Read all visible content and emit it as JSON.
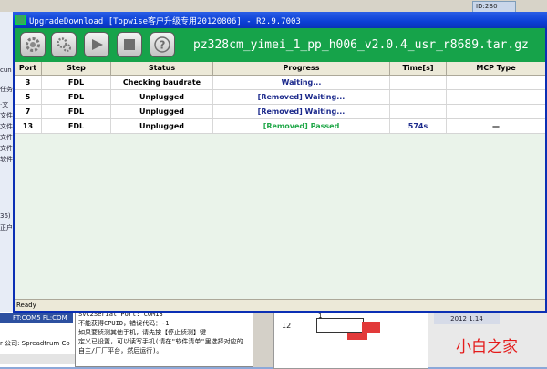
{
  "window": {
    "title": "UpgradeDownload [Topwise客户升级专用20120806] - R2.9.7003"
  },
  "toolbar": {
    "buttons": [
      {
        "name": "settings",
        "icon": "gear-icon"
      },
      {
        "name": "options",
        "icon": "cogs-icon"
      },
      {
        "name": "start",
        "icon": "play-icon"
      },
      {
        "name": "stop",
        "icon": "stop-icon"
      },
      {
        "name": "help",
        "icon": "question-icon"
      }
    ],
    "file_name": "pz328cm_yimei_1_pp_h006_v2.0.4_usr_r8689.tar.gz"
  },
  "table": {
    "columns": [
      "Port",
      "Step",
      "Status",
      "Progress",
      "Time[s]",
      "MCP Type"
    ],
    "rows": [
      {
        "port": "3",
        "step": "FDL",
        "status": "Checking baudrate",
        "progress": "Waiting...",
        "time": "",
        "mcp": ""
      },
      {
        "port": "5",
        "step": "FDL",
        "status": "Unplugged",
        "progress": "[Removed] Waiting...",
        "time": "",
        "mcp": ""
      },
      {
        "port": "7",
        "step": "FDL",
        "status": "Unplugged",
        "progress": "[Removed] Waiting...",
        "time": "",
        "mcp": ""
      },
      {
        "port": "13",
        "step": "FDL",
        "status": "Unplugged",
        "progress": "[Removed] Passed",
        "time": "574s",
        "mcp": "—"
      }
    ]
  },
  "statusbar": {
    "text": "Ready"
  },
  "background": {
    "tab_label": "ID:2B0",
    "strip_text": "FT:COM5 FL:COM",
    "company_text": "r 公司: Spreadtrum Co",
    "log_lines": [
      "SVC2Serial Port: COM13",
      "不能获得CPUID，错误代码：-1",
      "如果要侦测其他手机，请先按【停止侦测】键",
      "定义已设置，可以读写手机(请在\"软件清单\"里选择对应的",
      "自主/厂厂平台，然后运行)。"
    ],
    "schematic_labels": [
      "12",
      "1"
    ],
    "date_text": "2012 1.14",
    "left_labels": [
      "cun",
      "任务",
      "·文",
      "文件",
      "文件",
      "文件",
      "文件",
      "软件",
      "36)",
      "正户"
    ],
    "watermark": "小白之家"
  },
  "colors": {
    "titlebar": "#0b3fd6",
    "toolbar": "#16a34a",
    "waiting_text": "#1c2a8c",
    "passed_text": "#22a84a",
    "time_text": "#1c2a8c"
  }
}
